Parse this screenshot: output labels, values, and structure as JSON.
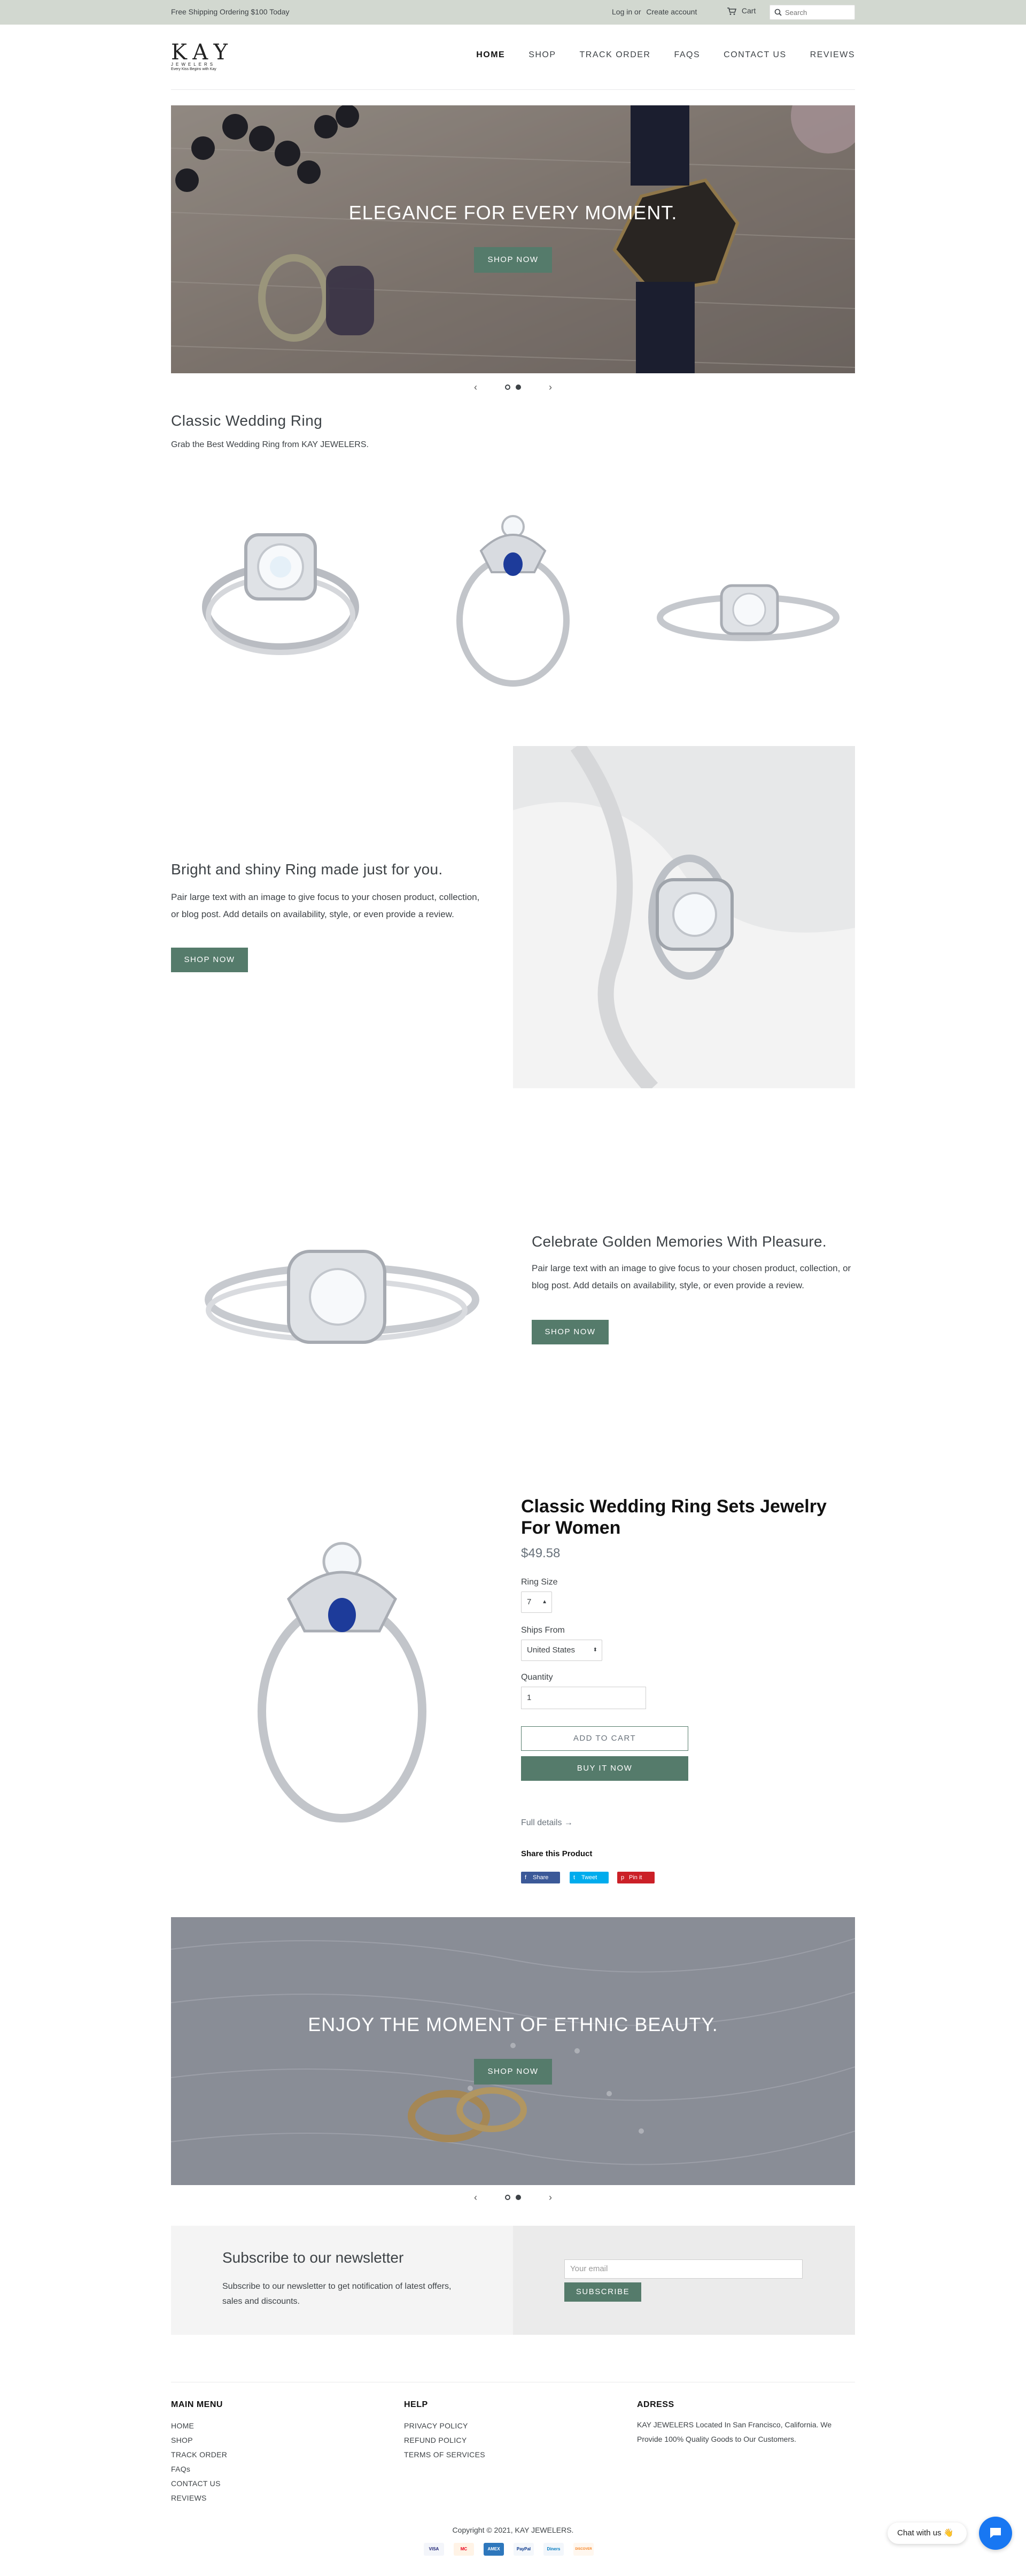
{
  "announcement": {
    "text": "Free Shipping Ordering $100 Today",
    "login": "Log in",
    "or": "or",
    "create_account": "Create account",
    "cart": "Cart",
    "search_placeholder": "Search"
  },
  "header": {
    "logo_text": "KAY",
    "logo_sub": "JEWELERS",
    "logo_tag": "Every Kiss Begins with Kay",
    "nav": [
      "HOME",
      "SHOP",
      "TRACK ORDER",
      "FAQS",
      "CONTACT US",
      "REVIEWS"
    ]
  },
  "hero": {
    "heading": "ELEGANCE FOR EVERY MOMENT.",
    "button": "SHOP NOW",
    "prev": "‹",
    "next": "›"
  },
  "featured_collection": {
    "title": "Classic Wedding Ring",
    "subtitle": "Grab the Best Wedding Ring from KAY JEWELERS."
  },
  "image_text_1": {
    "heading": "Bright and shiny Ring made just for you.",
    "body": "Pair large text with an image to give focus to your chosen product, collection, or blog post. Add details on availability, style, or even provide a review.",
    "button": "SHOP NOW"
  },
  "image_text_2": {
    "heading": "Celebrate Golden Memories With Pleasure.",
    "body": "Pair large text with an image to give focus to your chosen product, collection, or blog post. Add details on availability, style, or even provide a review.",
    "button": "SHOP NOW"
  },
  "featured_product": {
    "title": "Classic Wedding Ring Sets Jewelry For Women",
    "price": "$49.58",
    "ring_size_label": "Ring Size",
    "ring_size_value": "7",
    "ships_from_label": "Ships From",
    "ships_from_value": "United States",
    "quantity_label": "Quantity",
    "quantity_value": "1",
    "add_to_cart": "ADD TO CART",
    "buy_now": "BUY IT NOW",
    "full_details": "Full details →",
    "share_title": "Share this Product",
    "share_facebook": "Share",
    "share_twitter": "Tweet",
    "share_pinterest": "Pin it"
  },
  "hero2": {
    "heading": "ENJOY THE MOMENT OF ETHNIC BEAUTY.",
    "button": "SHOP NOW",
    "prev": "‹",
    "next": "›"
  },
  "newsletter": {
    "title": "Subscribe to our newsletter",
    "text": "Subscribe to our newsletter to get notification of latest offers, sales and discounts.",
    "placeholder": "Your email",
    "button": "SUBSCRIBE"
  },
  "footer": {
    "main_menu_title": "MAIN MENU",
    "main_menu": [
      "HOME",
      "SHOP",
      "TRACK ORDER",
      "FAQs",
      "CONTACT US",
      "REVIEWS"
    ],
    "help_title": "HELP",
    "help": [
      "PRIVACY POLICY",
      "REFUND POLICY",
      "TERMS OF SERVICES"
    ],
    "address_title": "ADRESS",
    "address": "KAY JEWELERS Located In San Francisco, California. We Provide 100% Quality Goods to Our Customers.",
    "copyright": "Copyright © 2021, KAY JEWELERS.",
    "payments": [
      "VISA",
      "MC",
      "AMEX",
      "PayPal",
      "Diners",
      "DISCOVER"
    ]
  },
  "chat": {
    "label": "Chat with us 👋"
  },
  "colors": {
    "accent": "#557b6b",
    "topbar": "#d2d8d0",
    "chat": "#1877f2"
  }
}
